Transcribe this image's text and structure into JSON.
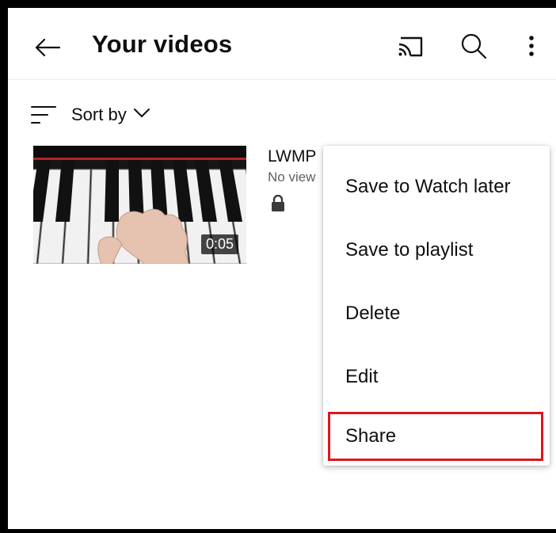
{
  "header": {
    "title": "Your videos",
    "icons": [
      "back-arrow-icon",
      "cast-icon",
      "search-icon",
      "more-vert-icon"
    ]
  },
  "sort": {
    "label": "Sort by"
  },
  "video": {
    "title": "LWMP",
    "meta": "No view",
    "duration": "0:05",
    "privacy_icon": "lock-icon"
  },
  "menu": {
    "items": [
      {
        "label": "Save to Watch later"
      },
      {
        "label": "Save to playlist"
      },
      {
        "label": "Delete"
      },
      {
        "label": "Edit"
      },
      {
        "label": "Share"
      }
    ],
    "highlight_color": "#e0141e"
  }
}
